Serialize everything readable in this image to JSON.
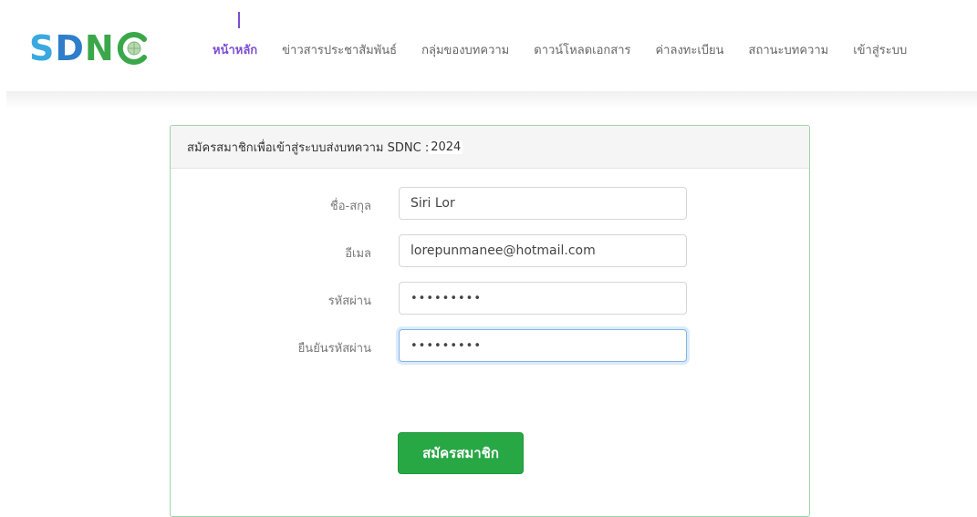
{
  "brand": {
    "logo_text_s": "S",
    "logo_text_d": "D",
    "logo_text_n": "N"
  },
  "nav": {
    "items": [
      {
        "label": "หน้าหลัก"
      },
      {
        "label": "ข่าวสารประชาสัมพันธ์"
      },
      {
        "label": "กลุ่มของบทความ"
      },
      {
        "label": "ดาวน์โหลดเอกสาร"
      },
      {
        "label": "ค่าลงทะเบียน"
      },
      {
        "label": "สถานะบทความ"
      },
      {
        "label": "เข้าสู่ระบบ"
      }
    ]
  },
  "panel": {
    "title": "สมัครสมาชิกเพื่อเข้าสู่ระบบส่งบทความ SDNC :",
    "year": "2024"
  },
  "form": {
    "fullname": {
      "label": "ชื่อ-สกุล",
      "value": "Siri Lor"
    },
    "email": {
      "label": "อีเมล",
      "value": "lorepunmanee@hotmail.com"
    },
    "password": {
      "label": "รหัสผ่าน",
      "value": "•••••••••"
    },
    "confirm": {
      "label": "ยืนยันรหัสผ่าน",
      "value": "•••••••••"
    },
    "submit_label": "สมัครสมาชิก"
  },
  "colors": {
    "accent": "#7b4fd3",
    "primary_button": "#28a745",
    "panel_border": "#9fd3a6"
  }
}
